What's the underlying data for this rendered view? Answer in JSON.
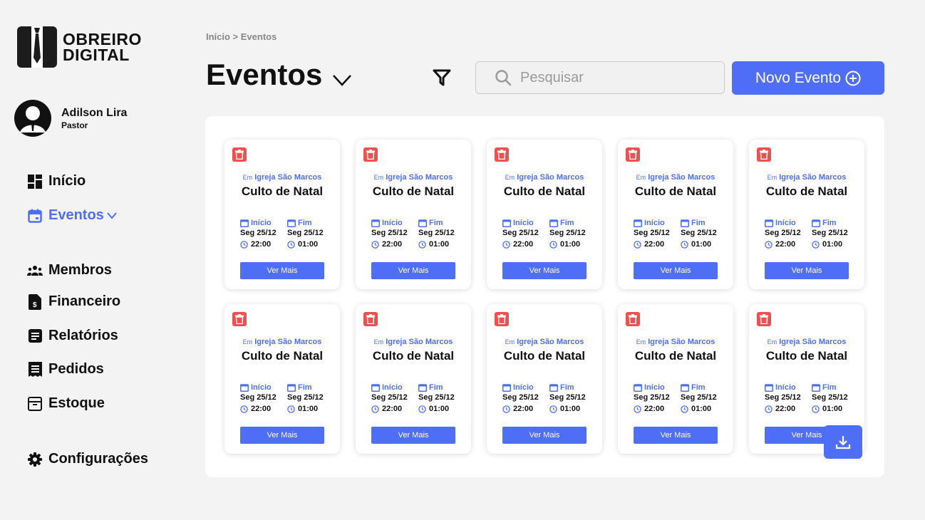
{
  "brand": {
    "line1": "OBREIRO",
    "line2": "DIGITAL"
  },
  "profile": {
    "name": "Adilson Lira",
    "role": "Pastor"
  },
  "nav": {
    "inicio": "Início",
    "eventos": "Eventos",
    "membros": "Membros",
    "financeiro": "Financeiro",
    "relatorios": "Relatórios",
    "pedidos": "Pedidos",
    "estoque": "Estoque",
    "configuracoes": "Configurações"
  },
  "breadcrumb": "Início > Eventos",
  "page_title": "Eventos",
  "search": {
    "placeholder": "Pesquisar"
  },
  "new_event_label": "Novo Evento",
  "colors": {
    "accent": "#4f6ef7",
    "danger": "#ef4f4f"
  },
  "events": [
    {
      "prefix": "Em",
      "location": "Igreja São Marcos",
      "title": "Culto de Natal",
      "start_label": "Início",
      "end_label": "Fim",
      "start_date": "Seg 25/12",
      "end_date": "Seg 25/12",
      "start_time": "22:00",
      "end_time": "01:00",
      "button": "Ver Mais"
    },
    {
      "prefix": "Em",
      "location": "Igreja São Marcos",
      "title": "Culto de Natal",
      "start_label": "Início",
      "end_label": "Fim",
      "start_date": "Seg 25/12",
      "end_date": "Seg 25/12",
      "start_time": "22:00",
      "end_time": "01:00",
      "button": "Ver Mais"
    },
    {
      "prefix": "Em",
      "location": "Igreja São Marcos",
      "title": "Culto de Natal",
      "start_label": "Início",
      "end_label": "Fim",
      "start_date": "Seg 25/12",
      "end_date": "Seg 25/12",
      "start_time": "22:00",
      "end_time": "01:00",
      "button": "Ver Mais"
    },
    {
      "prefix": "Em",
      "location": "Igreja São Marcos",
      "title": "Culto de Natal",
      "start_label": "Início",
      "end_label": "Fim",
      "start_date": "Seg 25/12",
      "end_date": "Seg 25/12",
      "start_time": "22:00",
      "end_time": "01:00",
      "button": "Ver Mais"
    },
    {
      "prefix": "Em",
      "location": "Igreja São Marcos",
      "title": "Culto de Natal",
      "start_label": "Início",
      "end_label": "Fim",
      "start_date": "Seg 25/12",
      "end_date": "Seg 25/12",
      "start_time": "22:00",
      "end_time": "01:00",
      "button": "Ver Mais"
    },
    {
      "prefix": "Em",
      "location": "Igreja São Marcos",
      "title": "Culto de Natal",
      "start_label": "Início",
      "end_label": "Fim",
      "start_date": "Seg 25/12",
      "end_date": "Seg 25/12",
      "start_time": "22:00",
      "end_time": "01:00",
      "button": "Ver Mais"
    },
    {
      "prefix": "Em",
      "location": "Igreja São Marcos",
      "title": "Culto de Natal",
      "start_label": "Início",
      "end_label": "Fim",
      "start_date": "Seg 25/12",
      "end_date": "Seg 25/12",
      "start_time": "22:00",
      "end_time": "01:00",
      "button": "Ver Mais"
    },
    {
      "prefix": "Em",
      "location": "Igreja São Marcos",
      "title": "Culto de Natal",
      "start_label": "Início",
      "end_label": "Fim",
      "start_date": "Seg 25/12",
      "end_date": "Seg 25/12",
      "start_time": "22:00",
      "end_time": "01:00",
      "button": "Ver Mais"
    },
    {
      "prefix": "Em",
      "location": "Igreja São Marcos",
      "title": "Culto de Natal",
      "start_label": "Início",
      "end_label": "Fim",
      "start_date": "Seg 25/12",
      "end_date": "Seg 25/12",
      "start_time": "22:00",
      "end_time": "01:00",
      "button": "Ver Mais"
    },
    {
      "prefix": "Em",
      "location": "Igreja São Marcos",
      "title": "Culto de Natal",
      "start_label": "Início",
      "end_label": "Fim",
      "start_date": "Seg 25/12",
      "end_date": "Seg 25/12",
      "start_time": "22:00",
      "end_time": "01:00",
      "button": "Ver Mais"
    }
  ]
}
